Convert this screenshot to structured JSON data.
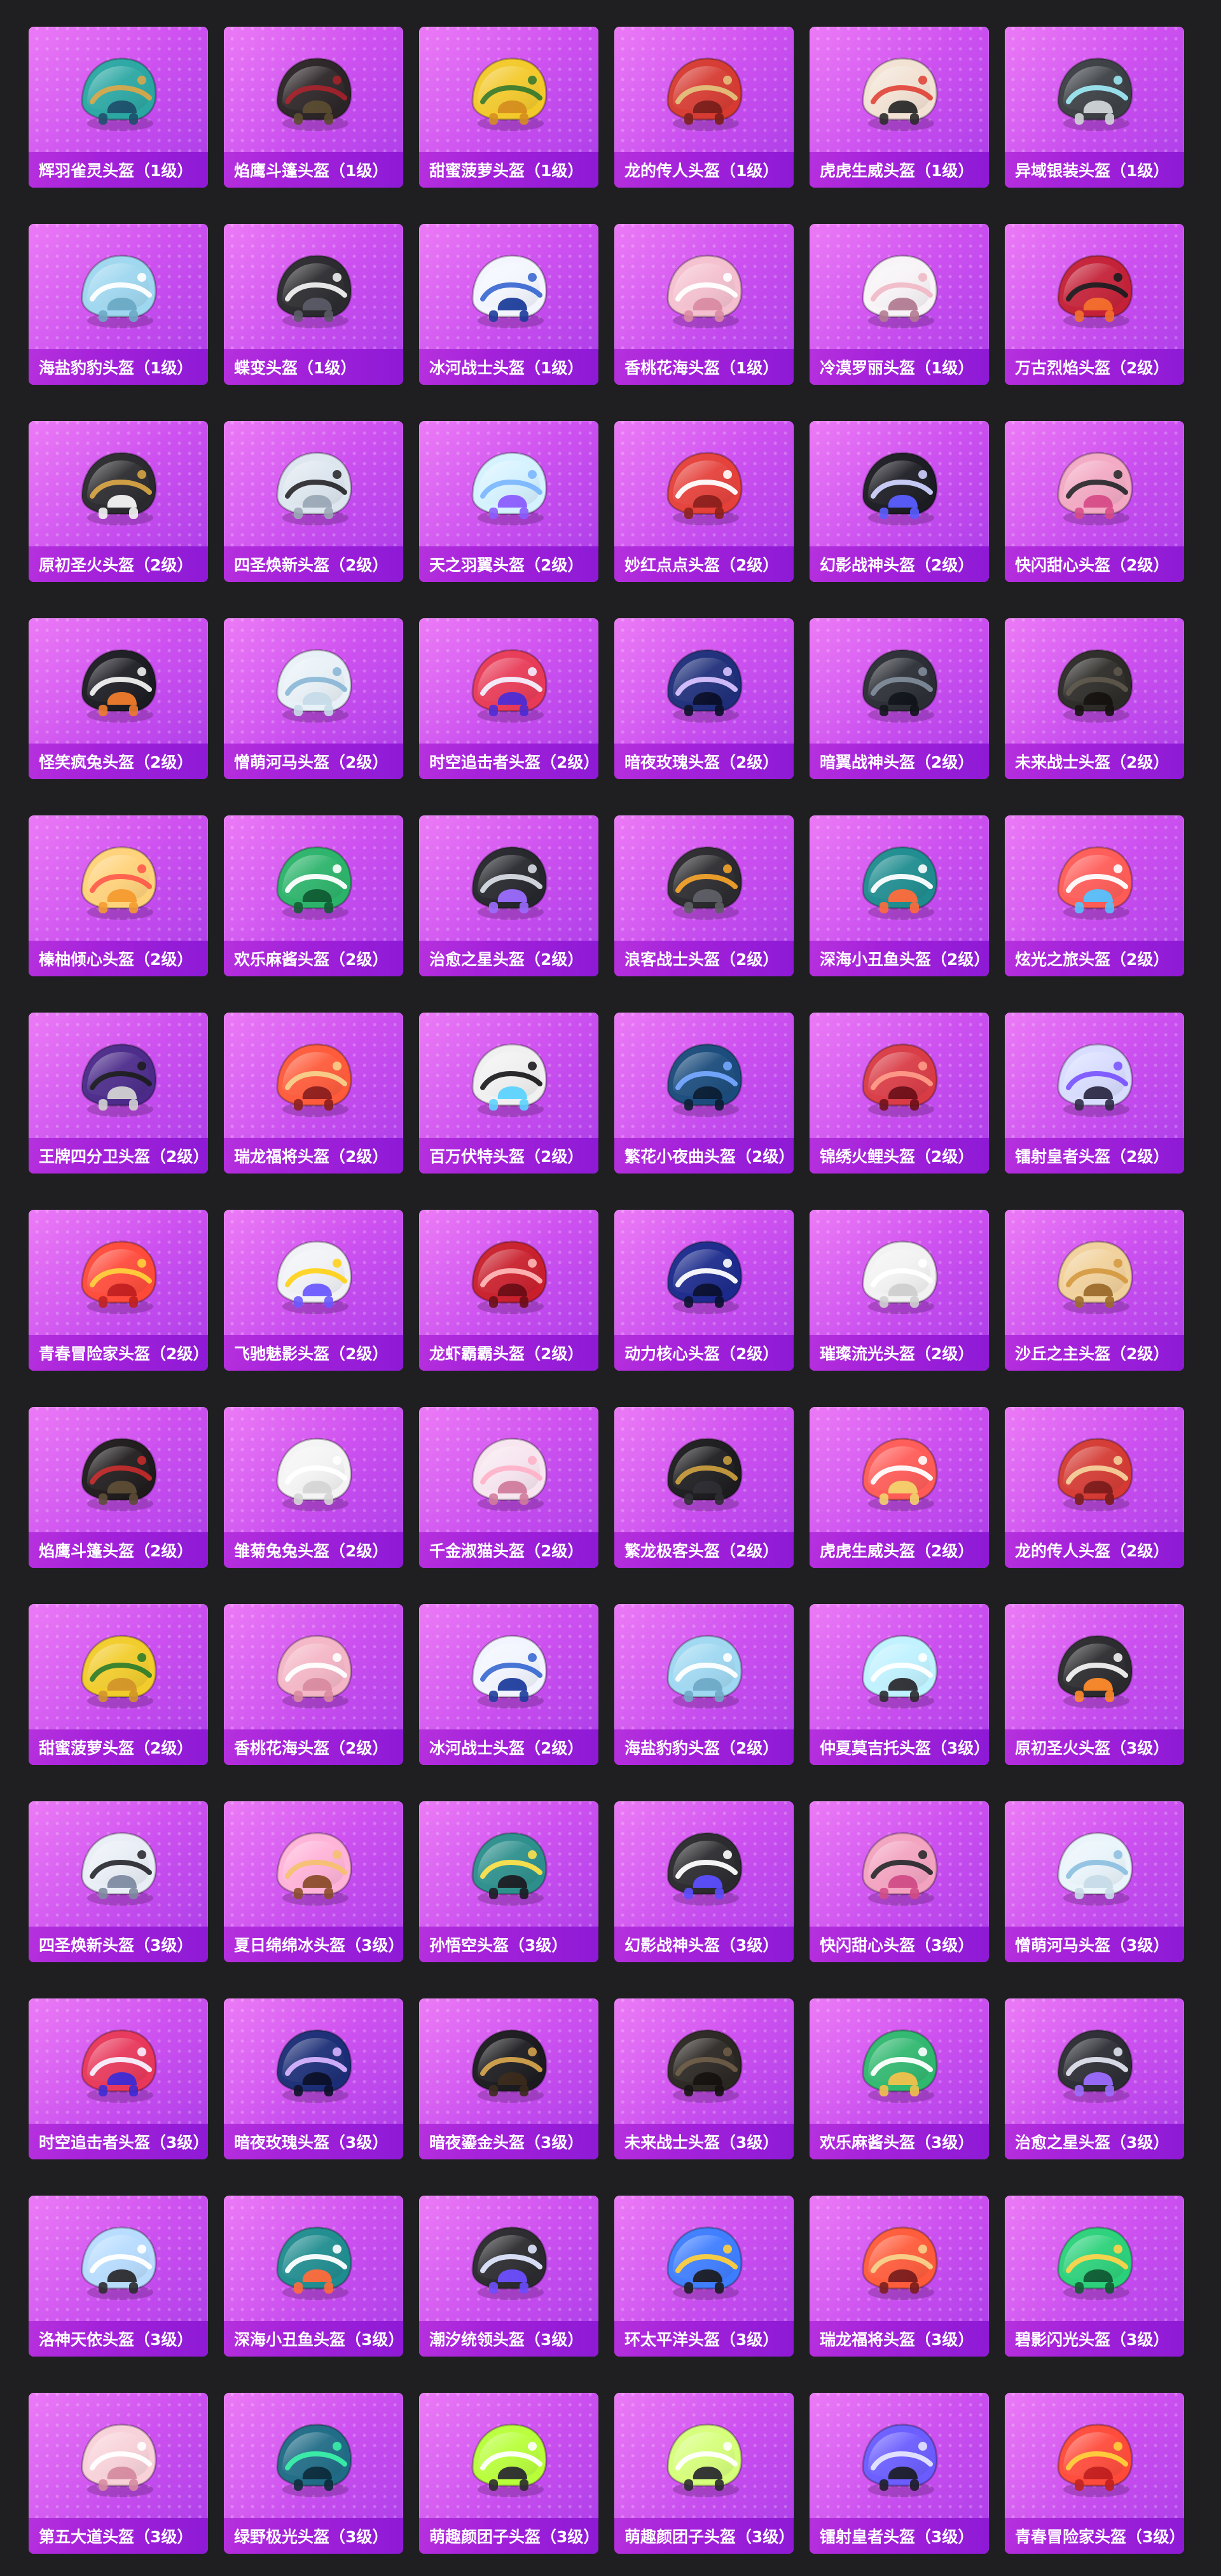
{
  "helmets": [
    {
      "label": "辉羽雀灵头盔（1级）",
      "primary": "#2aa7a3",
      "accent": "#d7a64a",
      "detail": "#1d4f6c"
    },
    {
      "label": "焰鹰斗篷头盔（1级）",
      "primary": "#2b2426",
      "accent": "#a3212a",
      "detail": "#5a4b2f"
    },
    {
      "label": "甜蜜菠萝头盔（1级）",
      "primary": "#f3c92a",
      "accent": "#3a7a2c",
      "detail": "#d58d1e"
    },
    {
      "label": "龙的传人头盔（1级）",
      "primary": "#d63a31",
      "accent": "#e3c07a",
      "detail": "#7a1e1a"
    },
    {
      "label": "虎虎生威头盔（1级）",
      "primary": "#f2e2d3",
      "accent": "#e0463a",
      "detail": "#2a2a2a"
    },
    {
      "label": "异域银装头盔（1级）",
      "primary": "#3b3f44",
      "accent": "#9be7f2",
      "detail": "#d0d5d8"
    },
    {
      "label": "海盐豹豹头盔（1级）",
      "primary": "#9ed7f0",
      "accent": "#ffffff",
      "detail": "#6aa9c4"
    },
    {
      "label": "蝶变头盔（1级）",
      "primary": "#2a2a2e",
      "accent": "#f0f0f0",
      "detail": "#5a5a66"
    },
    {
      "label": "冰河战士头盔（1级）",
      "primary": "#f4f6ff",
      "accent": "#3b68d2",
      "detail": "#1b3c9a"
    },
    {
      "label": "香桃花海头盔（1级）",
      "primary": "#f4c0cf",
      "accent": "#ffffff",
      "detail": "#d98aa2"
    },
    {
      "label": "冷漠罗丽头盔（1级）",
      "primary": "#f7f3f6",
      "accent": "#f0b9c7",
      "detail": "#b17a91"
    },
    {
      "label": "万古烈焰头盔（2级）",
      "primary": "#c42037",
      "accent": "#1b1b1f",
      "detail": "#f36f2b"
    },
    {
      "label": "原初圣火头盔（2级）",
      "primary": "#2a2a2e",
      "accent": "#d6a343",
      "detail": "#f5f5f5"
    },
    {
      "label": "四圣焕新头盔（2级）",
      "primary": "#dde6ef",
      "accent": "#2a2a2e",
      "detail": "#9aa7b5"
    },
    {
      "label": "天之羽翼头盔（2级）",
      "primary": "#d4f2ff",
      "accent": "#7bb6ff",
      "detail": "#8a5cff"
    },
    {
      "label": "妙红点点头盔（2级）",
      "primary": "#e5403a",
      "accent": "#ffffff",
      "detail": "#8b1f1b"
    },
    {
      "label": "幻影战神头盔（2级）",
      "primary": "#1b1b22",
      "accent": "#cfd2ff",
      "detail": "#5a5dff"
    },
    {
      "label": "快闪甜心头盔（2级）",
      "primary": "#f3a9c3",
      "accent": "#2a2a2e",
      "detail": "#d64a87"
    },
    {
      "label": "怪笑疯兔头盔（2级）",
      "primary": "#1b1b22",
      "accent": "#f1f1f1",
      "detail": "#f07b2a"
    },
    {
      "label": "憎萌河马头盔（2级）",
      "primary": "#e8f1f7",
      "accent": "#8bb7d6",
      "detail": "#c6dbe8"
    },
    {
      "label": "时空追击者头盔（2级）",
      "primary": "#e83a57",
      "accent": "#f3f0ff",
      "detail": "#4a2bd6"
    },
    {
      "label": "暗夜玫瑰头盔（2级）",
      "primary": "#1e2e7a",
      "accent": "#d7c1ff",
      "detail": "#0a0f28"
    },
    {
      "label": "暗翼战神头盔（2级）",
      "primary": "#2a2d34",
      "accent": "#7e8a99",
      "detail": "#10141a"
    },
    {
      "label": "未来战士头盔（2级）",
      "primary": "#2c2a27",
      "accent": "#5c554a",
      "detail": "#14110f"
    },
    {
      "label": "榛柚倾心头盔（2级）",
      "primary": "#ffd27a",
      "accent": "#ff5b4a",
      "detail": "#f49a2e"
    },
    {
      "label": "欢乐麻酱头盔（2级）",
      "primary": "#2bb36a",
      "accent": "#ffffff",
      "detail": "#0f5b33"
    },
    {
      "label": "治愈之星头盔（2级）",
      "primary": "#24262b",
      "accent": "#d7dbe4",
      "detail": "#9b6bff"
    },
    {
      "label": "浪客战士头盔（2级）",
      "primary": "#2a2a2e",
      "accent": "#f2a128",
      "detail": "#5e5e66"
    },
    {
      "label": "深海小丑鱼头盔（2级）",
      "primary": "#1e8c8f",
      "accent": "#ffffff",
      "detail": "#ff6a3a"
    },
    {
      "label": "炫光之旅头盔（2级）",
      "primary": "#ff5b57",
      "accent": "#ffffff",
      "detail": "#54c2ff"
    },
    {
      "label": "王牌四分卫头盔（2级）",
      "primary": "#4b2a8a",
      "accent": "#1c1c1f",
      "detail": "#d2d2d2"
    },
    {
      "label": "瑞龙福将头盔（2级）",
      "primary": "#ff5a3a",
      "accent": "#f7d08a",
      "detail": "#8b1d1d"
    },
    {
      "label": "百万伏特头盔（2级）",
      "primary": "#f0f0f0",
      "accent": "#1b1b1f",
      "detail": "#5bd3ff"
    },
    {
      "label": "繁花小夜曲头盔（2级）",
      "primary": "#1a4b7c",
      "accent": "#74a6ff",
      "detail": "#0b1c33"
    },
    {
      "label": "锦绣火鲤头盔（2级）",
      "primary": "#d93b45",
      "accent": "#ff9a87",
      "detail": "#6d0f18"
    },
    {
      "label": "镭射皇者头盔（2级）",
      "primary": "#d8dcff",
      "accent": "#7a54ff",
      "detail": "#2d2a44"
    },
    {
      "label": "青春冒险家头盔（2级）",
      "primary": "#ff4a3a",
      "accent": "#ffd03a",
      "detail": "#c01f1f"
    },
    {
      "label": "飞驰魅影头盔（2级）",
      "primary": "#f0f2f6",
      "accent": "#ffd21a",
      "detail": "#6a58ff"
    },
    {
      "label": "龙虾霸霸头盔（2级）",
      "primary": "#c91f2c",
      "accent": "#ffb6b6",
      "detail": "#6b0c15"
    },
    {
      "label": "动力核心头盔（2级）",
      "primary": "#1b2a8c",
      "accent": "#ffffff",
      "detail": "#0b102f"
    },
    {
      "label": "璀璨流光头盔（2级）",
      "primary": "#f2f2f2",
      "accent": "#ffffff",
      "detail": "#cfcfcf"
    },
    {
      "label": "沙丘之主头盔（2级）",
      "primary": "#f1d19b",
      "accent": "#d59a41",
      "detail": "#9b6a2a"
    },
    {
      "label": "焰鹰斗篷头盔（2级）",
      "primary": "#1f1b1c",
      "accent": "#c12a2a",
      "detail": "#5c4c35"
    },
    {
      "label": "雏菊兔兔头盔（2级）",
      "primary": "#f4f4f4",
      "accent": "#ffffff",
      "detail": "#d5d5d5"
    },
    {
      "label": "千金淑猫头盔（2级）",
      "primary": "#f7e5ef",
      "accent": "#ffb2c9",
      "detail": "#d07b9b"
    },
    {
      "label": "繁龙极客头盔（2级）",
      "primary": "#1c1c1f",
      "accent": "#c89b3c",
      "detail": "#2d2d33"
    },
    {
      "label": "虎虎生威头盔（2级）",
      "primary": "#ff5b57",
      "accent": "#ffffff",
      "detail": "#f4d26b"
    },
    {
      "label": "龙的传人头盔（2级）",
      "primary": "#d43a33",
      "accent": "#f4d09a",
      "detail": "#7b1b1b"
    },
    {
      "label": "甜蜜菠萝头盔（2级）",
      "primary": "#f2cc2a",
      "accent": "#2f7d2a",
      "detail": "#d29328"
    },
    {
      "label": "香桃花海头盔（2级）",
      "primary": "#f4b6c7",
      "accent": "#ffffff",
      "detail": "#d88aa0"
    },
    {
      "label": "冰河战士头盔（2级）",
      "primary": "#f2f5ff",
      "accent": "#3b6ad2",
      "detail": "#1c3c9c"
    },
    {
      "label": "海盐豹豹头盔（2级）",
      "primary": "#9fd8f2",
      "accent": "#ffffff",
      "detail": "#6ea9c7"
    },
    {
      "label": "仲夏莫吉托头盔（3级）",
      "primary": "#bff2ff",
      "accent": "#ffffff",
      "detail": "#2a2a2e"
    },
    {
      "label": "原初圣火头盔（3级）",
      "primary": "#2a2a2e",
      "accent": "#f2f2f2",
      "detail": "#ff8a2a"
    },
    {
      "label": "四圣焕新头盔（3级）",
      "primary": "#e9eef6",
      "accent": "#2b2b31",
      "detail": "#7d8aa0"
    },
    {
      "label": "夏日绵绵冰头盔（3级）",
      "primary": "#ffb3d8",
      "accent": "#f5c06f",
      "detail": "#8a4b2a"
    },
    {
      "label": "孙悟空头盔（3级）",
      "primary": "#2c8f8c",
      "accent": "#ffe14a",
      "detail": "#1b1b22"
    },
    {
      "label": "幻影战神头盔（3级）",
      "primary": "#2a2a2e",
      "accent": "#ffffff",
      "detail": "#5b4dff"
    },
    {
      "label": "快闪甜心头盔（3级）",
      "primary": "#f3a3c0",
      "accent": "#2a2a2e",
      "detail": "#d04b86"
    },
    {
      "label": "憎萌河马头盔（3级）",
      "primary": "#e9f4fb",
      "accent": "#8ec0e0",
      "detail": "#c6dbe8"
    },
    {
      "label": "时空追击者头盔（3级）",
      "primary": "#e8375a",
      "accent": "#f7f2ff",
      "detail": "#3b2ad6"
    },
    {
      "label": "暗夜玫瑰头盔（3级）",
      "primary": "#1b2d76",
      "accent": "#d7b2ff",
      "detail": "#0b1028"
    },
    {
      "label": "暗夜鎏金头盔（3级）",
      "primary": "#1b1b1f",
      "accent": "#d3a24b",
      "detail": "#3a2a1a"
    },
    {
      "label": "未来战士头盔（3级）",
      "primary": "#2a2622",
      "accent": "#6b5b46",
      "detail": "#14110f"
    },
    {
      "label": "欢乐麻酱头盔（3级）",
      "primary": "#30b86f",
      "accent": "#ffffff",
      "detail": "#f2c14a"
    },
    {
      "label": "治愈之星头盔（3级）",
      "primary": "#2b2c33",
      "accent": "#dfe3ee",
      "detail": "#9b6bff"
    },
    {
      "label": "洛神天依头盔（3级）",
      "primary": "#b7dcff",
      "accent": "#ffffff",
      "detail": "#2a2a2e"
    },
    {
      "label": "深海小丑鱼头盔（3级）",
      "primary": "#1f8c8f",
      "accent": "#ffffff",
      "detail": "#ff6a3a"
    },
    {
      "label": "潮汐统领头盔（3级）",
      "primary": "#2a2a2e",
      "accent": "#dfe7ff",
      "detail": "#6b4dff"
    },
    {
      "label": "环太平洋头盔（3级）",
      "primary": "#3d7dff",
      "accent": "#ffcf3a",
      "detail": "#1b1b22"
    },
    {
      "label": "瑞龙福将头盔（3级）",
      "primary": "#ff5b3a",
      "accent": "#f7d28a",
      "detail": "#7a1c1c"
    },
    {
      "label": "碧影闪光头盔（3级）",
      "primary": "#2bd17a",
      "accent": "#ffd34a",
      "detail": "#0f5a33"
    },
    {
      "label": "第五大道头盔（3级）",
      "primary": "#f8d1d9",
      "accent": "#ffffff",
      "detail": "#d58aa0"
    },
    {
      "label": "绿野极光头盔（3级）",
      "primary": "#1f6b86",
      "accent": "#38f0a8",
      "detail": "#0c2b3b"
    },
    {
      "label": "萌趣颜团子头盔（3级）",
      "primary": "#b8ff3a",
      "accent": "#ffffff",
      "detail": "#2a2a2e"
    },
    {
      "label": "萌趣颜团子头盔（3级）",
      "primary": "#d6ff7a",
      "accent": "#ffffff",
      "detail": "#2a2a2e"
    },
    {
      "label": "镭射皇者头盔（3级）",
      "primary": "#6a5cff",
      "accent": "#e6e6ff",
      "detail": "#1c1c28"
    },
    {
      "label": "青春冒险家头盔（3级）",
      "primary": "#ff4a3a",
      "accent": "#ffd03a",
      "detail": "#c01f1f"
    }
  ]
}
